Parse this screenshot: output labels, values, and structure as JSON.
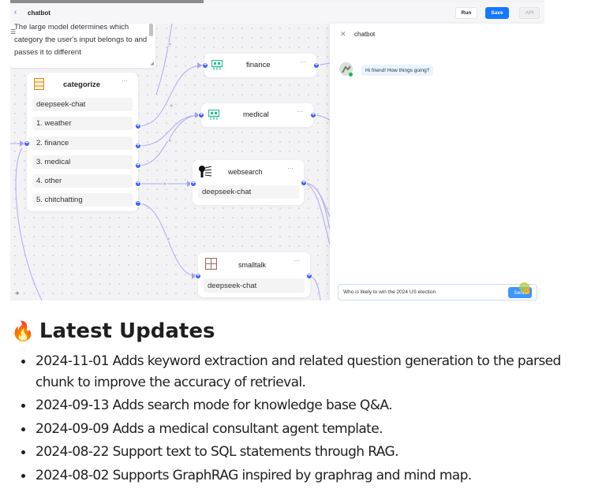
{
  "app": {
    "title": "chatbot",
    "back_icon": "chevron-left-icon",
    "buttons": {
      "run": "Run",
      "save": "Save",
      "api": "API"
    }
  },
  "colors": {
    "accent": "#1677ff",
    "handle": "#3b5bfd",
    "edge": "#b8b4f4",
    "canvas": "#f3f3f5"
  },
  "description": {
    "text": "The large model determines which category the user's input belongs to and passes it to different"
  },
  "nodes": {
    "categorize": {
      "title": "categorize",
      "icon": "categorize-icon",
      "menu": "···",
      "model": "deepseek-chat",
      "categories": [
        "1. weather",
        "2. finance",
        "3. medical",
        "4. other",
        "5. chitchatting"
      ]
    },
    "finance": {
      "title": "finance",
      "icon": "finance-icon",
      "menu": "···"
    },
    "medical": {
      "title": "medical",
      "icon": "medical-icon",
      "menu": "···"
    },
    "websearch": {
      "title": "websearch",
      "icon": "websearch-icon",
      "menu": "···",
      "model": "deepseek-chat"
    },
    "smalltalk": {
      "title": "smalltalk",
      "icon": "smalltalk-icon",
      "menu": "···",
      "model": "deepseek-chat"
    }
  },
  "zoom_controls": {
    "zoom_in": "+",
    "zoom_out": "−",
    "fit": "⛶"
  },
  "chat": {
    "title": "chatbot",
    "greeting": "Hi friend! How things going?",
    "input_value": "Who is likely to win the 2024 US election",
    "send_label": "Send"
  },
  "updates": {
    "title": "Latest Updates",
    "icon": "fire-icon",
    "items": [
      "2024-11-01 Adds keyword extraction and related question generation to the parsed chunk to improve the accuracy of retrieval.",
      "2024-09-13 Adds search mode for knowledge base Q&A.",
      "2024-09-09 Adds a medical consultant agent template.",
      "2024-08-22 Support text to SQL statements through RAG.",
      "2024-08-02 Supports GraphRAG inspired by graphrag and mind map."
    ]
  }
}
